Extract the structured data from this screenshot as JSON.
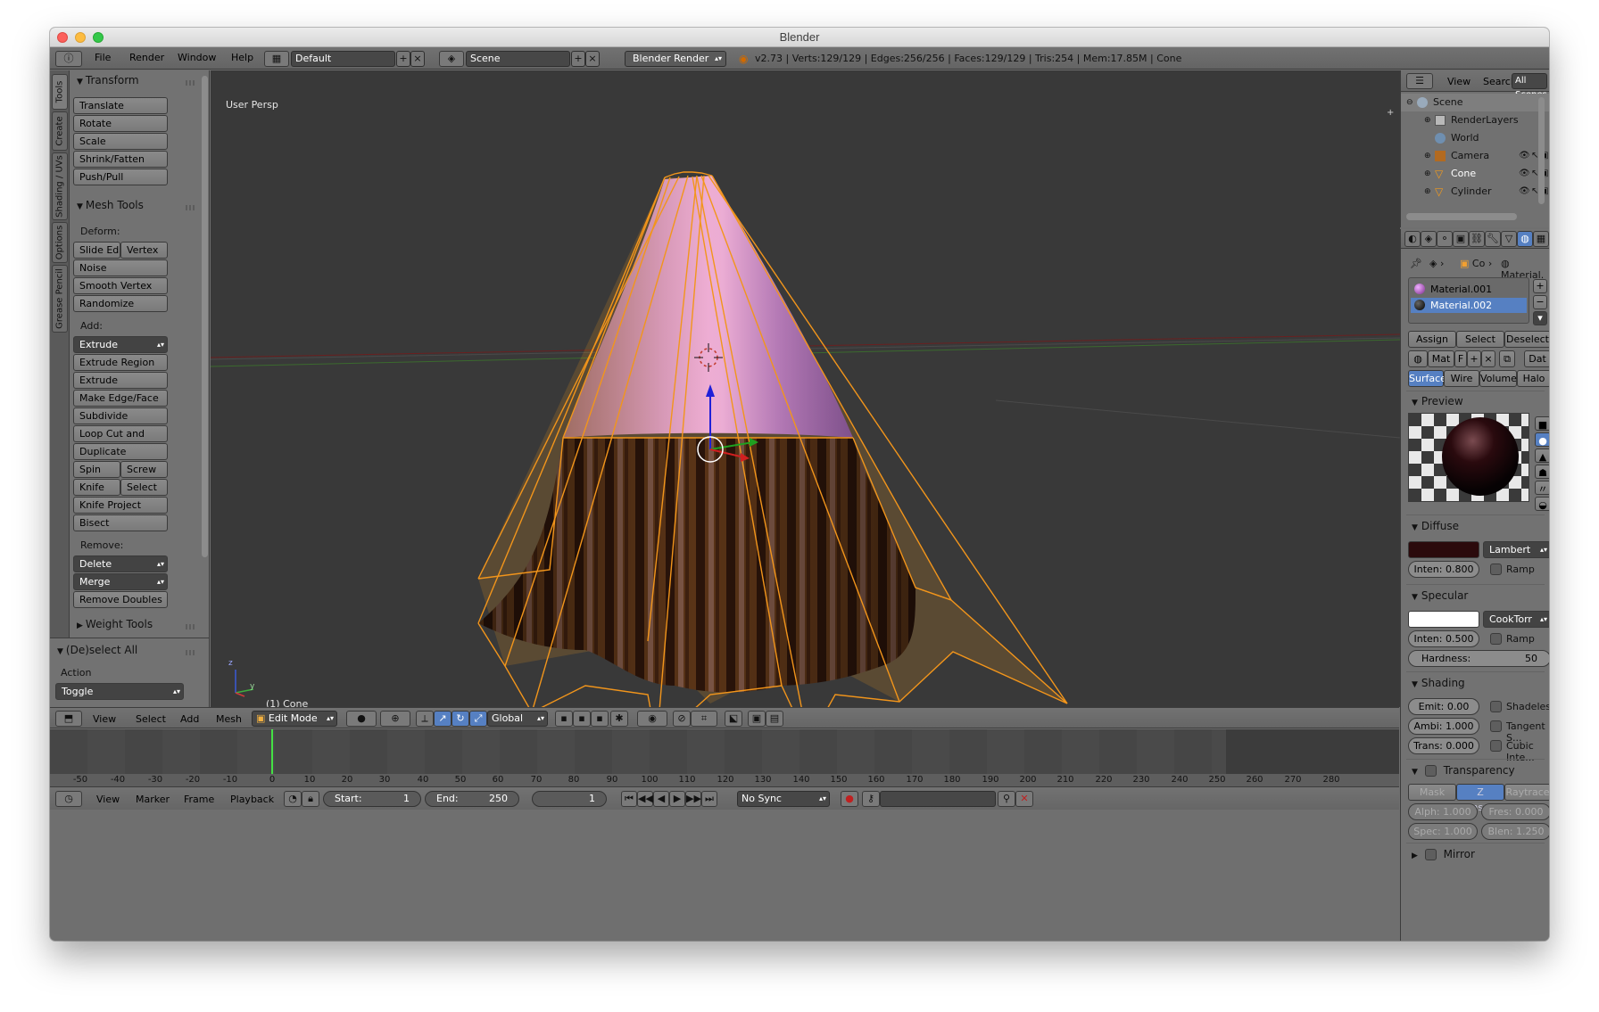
{
  "window": {
    "title": "Blender"
  },
  "topbar": {
    "menus": [
      "File",
      "Render",
      "Window",
      "Help"
    ],
    "layout": "Default",
    "scene": "Scene",
    "engine": "Blender Render",
    "stats": "v2.73 | Verts:129/129 | Edges:256/256 | Faces:129/129 | Tris:254 | Mem:17.85M | Cone"
  },
  "tool_tabs": [
    "Tools",
    "Create",
    "Shading / UVs",
    "Options",
    "Grease Pencil"
  ],
  "toolshelf": {
    "transform": {
      "title": "Transform",
      "buttons": [
        "Translate",
        "Rotate",
        "Scale",
        "Shrink/Fatten",
        "Push/Pull"
      ]
    },
    "mesh_tools": {
      "title": "Mesh Tools",
      "deform_label": "Deform:",
      "slide_edge": "Slide Ed",
      "vertex": "Vertex",
      "noise": "Noise",
      "smooth_vertex": "Smooth Vertex",
      "randomize": "Randomize",
      "add_label": "Add:",
      "extrude": "Extrude",
      "add_buttons": [
        "Extrude Region",
        "Extrude Individual",
        "Make Edge/Face",
        "Subdivide",
        "Loop Cut and Slide",
        "Duplicate"
      ],
      "spin": "Spin",
      "screw": "Screw",
      "knife": "Knife",
      "select": "Select",
      "knife_project": "Knife Project",
      "bisect": "Bisect",
      "remove_label": "Remove:",
      "delete": "Delete",
      "merge": "Merge",
      "remove_doubles": "Remove Doubles"
    },
    "weight_tools": {
      "title": "Weight Tools"
    }
  },
  "operator": {
    "title": "(De)select All",
    "action_label": "Action",
    "action_value": "Toggle"
  },
  "viewport": {
    "view_label": "User Persp",
    "object_label": "(1) Cone",
    "axis_x": "x",
    "axis_y": "y",
    "axis_z": "z"
  },
  "view_header": {
    "menus": [
      "View",
      "Select",
      "Add",
      "Mesh"
    ],
    "mode": "Edit Mode",
    "orientation": "Global"
  },
  "timeline": {
    "ticks": [
      "-50",
      "-40",
      "-30",
      "-20",
      "-10",
      "0",
      "10",
      "20",
      "30",
      "40",
      "50",
      "60",
      "70",
      "80",
      "90",
      "100",
      "110",
      "120",
      "130",
      "140",
      "150",
      "160",
      "170",
      "180",
      "190",
      "200",
      "210",
      "220",
      "230",
      "240",
      "250",
      "260",
      "270",
      "280"
    ],
    "current_frame": 1
  },
  "footer": {
    "menus": [
      "View",
      "Marker",
      "Frame",
      "Playback"
    ],
    "start_label": "Start:",
    "start_value": "1",
    "end_label": "End:",
    "end_value": "250",
    "frame_value": "1",
    "sync": "No Sync"
  },
  "outliner": {
    "menus": [
      "View",
      "Search"
    ],
    "filter": "All Scenes",
    "items": [
      {
        "label": "Scene",
        "indent": 0
      },
      {
        "label": "RenderLayers",
        "indent": 1
      },
      {
        "label": "World",
        "indent": 1
      },
      {
        "label": "Camera",
        "indent": 1
      },
      {
        "label": "Cone",
        "indent": 1
      },
      {
        "label": "Cylinder",
        "indent": 1
      }
    ]
  },
  "properties": {
    "breadcrumb_object": "Co",
    "breadcrumb_material": "Material.",
    "materials": [
      "Material.001",
      "Material.002"
    ],
    "selected_material": "Material.002",
    "assign": "Assign",
    "select": "Select",
    "deselect": "Deselect",
    "mat_field": "Mat",
    "f_button": "F",
    "data_button": "Dat",
    "tabs": [
      "Surface",
      "Wire",
      "Volume",
      "Halo"
    ],
    "active_tab": "Surface",
    "preview_title": "Preview",
    "diffuse": {
      "title": "Diffuse",
      "color": "#2b0a0c",
      "shader": "Lambert",
      "intensity": "Inten: 0.800",
      "ramp": "Ramp"
    },
    "specular": {
      "title": "Specular",
      "color": "#ffffff",
      "shader": "CookTorr",
      "intensity": "Inten: 0.500",
      "ramp": "Ramp",
      "hardness_label": "Hardness:",
      "hardness_value": "50"
    },
    "shading": {
      "title": "Shading",
      "emit": "Emit:  0.00",
      "ambi": "Ambi: 1.000",
      "trans": "Trans: 0.000",
      "shadeless": "Shadeless",
      "tangent": "Tangent S...",
      "cubic": "Cubic Inte..."
    },
    "transparency": {
      "title": "Transparency",
      "modes": [
        "Mask",
        "Z Transpa...",
        "Raytrace"
      ],
      "active_mode": "Z Transpa...",
      "alpha": "Alph: 1.000",
      "fresnel": "Fres: 0.000",
      "spec": "Spec: 1.000",
      "blend": "Blen: 1.250"
    },
    "mirror": {
      "title": "Mirror"
    }
  },
  "colors": {
    "accent_blue": "#5680c2",
    "selection_orange": "#f29a1d",
    "viewport_bg": "#393939"
  }
}
